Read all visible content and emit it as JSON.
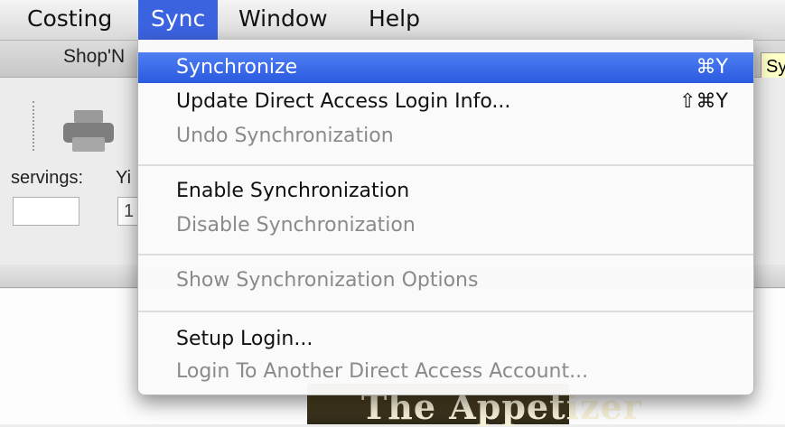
{
  "menubar": {
    "items": [
      {
        "label": "Costing"
      },
      {
        "label": "Sync"
      },
      {
        "label": "Window"
      },
      {
        "label": "Help"
      }
    ]
  },
  "toolbar": {
    "tab_label": "Shop'N",
    "tooltip": "Sy"
  },
  "form": {
    "servings_label": "servings:",
    "yield_label": "Yi",
    "yield_value": "1"
  },
  "background": {
    "book_title": "The Appetizer"
  },
  "sync_menu": {
    "items": [
      {
        "label": "Synchronize",
        "shortcut": "⌘Y",
        "state": "selected"
      },
      {
        "label": "Update Direct Access Login Info...",
        "shortcut": "⇧⌘Y",
        "state": "enabled"
      },
      {
        "label": "Undo Synchronization",
        "shortcut": "",
        "state": "disabled"
      },
      {
        "label": "Enable Synchronization",
        "shortcut": "",
        "state": "enabled"
      },
      {
        "label": "Disable Synchronization",
        "shortcut": "",
        "state": "disabled"
      },
      {
        "label": "Show Synchronization Options",
        "shortcut": "",
        "state": "disabled"
      },
      {
        "label": "Setup Login...",
        "shortcut": "",
        "state": "enabled"
      },
      {
        "label": "Login To Another Direct Access Account...",
        "shortcut": "",
        "state": "disabled"
      }
    ]
  },
  "colors": {
    "selection": "#2a5ae0",
    "menubar_active": "#3b63e0",
    "disabled_text": "#8a8a8a"
  },
  "icons": [
    "printer-icon"
  ]
}
